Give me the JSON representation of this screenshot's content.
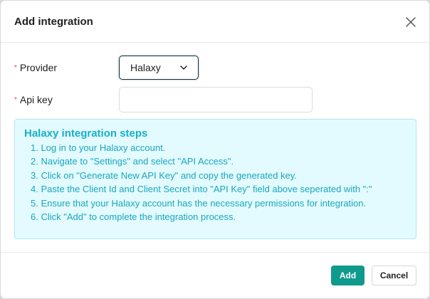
{
  "dialog": {
    "title": "Add integration",
    "close_icon": "close-icon"
  },
  "form": {
    "required_marker": "*",
    "provider": {
      "label": "Provider",
      "selected": "Halaxy",
      "dropdown_icon": "chevron-down-icon"
    },
    "api_key": {
      "label": "Api key",
      "value": "",
      "placeholder": ""
    }
  },
  "info": {
    "title": "Halaxy integration steps",
    "steps": [
      "1. Log in to your Halaxy account.",
      "2. Navigate to \"Settings\" and select \"API Access\".",
      "3. Click on \"Generate New API Key\" and copy the generated key.",
      "4. Paste the Client Id and Client Secret into \"API Key\" field above seperated with \":\"",
      "5. Ensure that your Halaxy account has the necessary permissions for integration.",
      "6. Click \"Add\" to complete the integration process."
    ]
  },
  "footer": {
    "add_label": "Add",
    "cancel_label": "Cancel"
  },
  "colors": {
    "primary": "#0f9a8c",
    "info_bg": "#e3fbff",
    "info_text": "#19a6bd",
    "required": "#e5484d"
  }
}
